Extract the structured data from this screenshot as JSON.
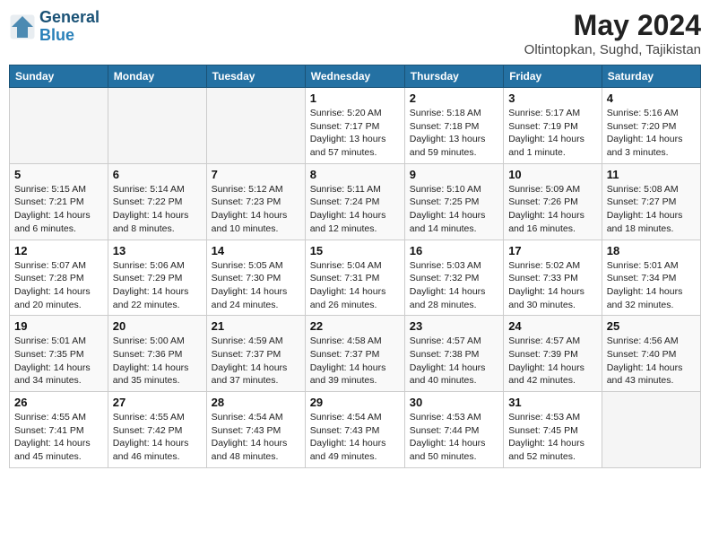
{
  "header": {
    "logo_line1": "General",
    "logo_line2": "Blue",
    "month": "May 2024",
    "location": "Oltintopkan, Sughd, Tajikistan"
  },
  "days_of_week": [
    "Sunday",
    "Monday",
    "Tuesday",
    "Wednesday",
    "Thursday",
    "Friday",
    "Saturday"
  ],
  "weeks": [
    [
      {
        "day": "",
        "empty": true
      },
      {
        "day": "",
        "empty": true
      },
      {
        "day": "",
        "empty": true
      },
      {
        "day": "1",
        "sunrise": "Sunrise: 5:20 AM",
        "sunset": "Sunset: 7:17 PM",
        "daylight": "Daylight: 13 hours and 57 minutes."
      },
      {
        "day": "2",
        "sunrise": "Sunrise: 5:18 AM",
        "sunset": "Sunset: 7:18 PM",
        "daylight": "Daylight: 13 hours and 59 minutes."
      },
      {
        "day": "3",
        "sunrise": "Sunrise: 5:17 AM",
        "sunset": "Sunset: 7:19 PM",
        "daylight": "Daylight: 14 hours and 1 minute."
      },
      {
        "day": "4",
        "sunrise": "Sunrise: 5:16 AM",
        "sunset": "Sunset: 7:20 PM",
        "daylight": "Daylight: 14 hours and 3 minutes."
      }
    ],
    [
      {
        "day": "5",
        "sunrise": "Sunrise: 5:15 AM",
        "sunset": "Sunset: 7:21 PM",
        "daylight": "Daylight: 14 hours and 6 minutes."
      },
      {
        "day": "6",
        "sunrise": "Sunrise: 5:14 AM",
        "sunset": "Sunset: 7:22 PM",
        "daylight": "Daylight: 14 hours and 8 minutes."
      },
      {
        "day": "7",
        "sunrise": "Sunrise: 5:12 AM",
        "sunset": "Sunset: 7:23 PM",
        "daylight": "Daylight: 14 hours and 10 minutes."
      },
      {
        "day": "8",
        "sunrise": "Sunrise: 5:11 AM",
        "sunset": "Sunset: 7:24 PM",
        "daylight": "Daylight: 14 hours and 12 minutes."
      },
      {
        "day": "9",
        "sunrise": "Sunrise: 5:10 AM",
        "sunset": "Sunset: 7:25 PM",
        "daylight": "Daylight: 14 hours and 14 minutes."
      },
      {
        "day": "10",
        "sunrise": "Sunrise: 5:09 AM",
        "sunset": "Sunset: 7:26 PM",
        "daylight": "Daylight: 14 hours and 16 minutes."
      },
      {
        "day": "11",
        "sunrise": "Sunrise: 5:08 AM",
        "sunset": "Sunset: 7:27 PM",
        "daylight": "Daylight: 14 hours and 18 minutes."
      }
    ],
    [
      {
        "day": "12",
        "sunrise": "Sunrise: 5:07 AM",
        "sunset": "Sunset: 7:28 PM",
        "daylight": "Daylight: 14 hours and 20 minutes."
      },
      {
        "day": "13",
        "sunrise": "Sunrise: 5:06 AM",
        "sunset": "Sunset: 7:29 PM",
        "daylight": "Daylight: 14 hours and 22 minutes."
      },
      {
        "day": "14",
        "sunrise": "Sunrise: 5:05 AM",
        "sunset": "Sunset: 7:30 PM",
        "daylight": "Daylight: 14 hours and 24 minutes."
      },
      {
        "day": "15",
        "sunrise": "Sunrise: 5:04 AM",
        "sunset": "Sunset: 7:31 PM",
        "daylight": "Daylight: 14 hours and 26 minutes."
      },
      {
        "day": "16",
        "sunrise": "Sunrise: 5:03 AM",
        "sunset": "Sunset: 7:32 PM",
        "daylight": "Daylight: 14 hours and 28 minutes."
      },
      {
        "day": "17",
        "sunrise": "Sunrise: 5:02 AM",
        "sunset": "Sunset: 7:33 PM",
        "daylight": "Daylight: 14 hours and 30 minutes."
      },
      {
        "day": "18",
        "sunrise": "Sunrise: 5:01 AM",
        "sunset": "Sunset: 7:34 PM",
        "daylight": "Daylight: 14 hours and 32 minutes."
      }
    ],
    [
      {
        "day": "19",
        "sunrise": "Sunrise: 5:01 AM",
        "sunset": "Sunset: 7:35 PM",
        "daylight": "Daylight: 14 hours and 34 minutes."
      },
      {
        "day": "20",
        "sunrise": "Sunrise: 5:00 AM",
        "sunset": "Sunset: 7:36 PM",
        "daylight": "Daylight: 14 hours and 35 minutes."
      },
      {
        "day": "21",
        "sunrise": "Sunrise: 4:59 AM",
        "sunset": "Sunset: 7:37 PM",
        "daylight": "Daylight: 14 hours and 37 minutes."
      },
      {
        "day": "22",
        "sunrise": "Sunrise: 4:58 AM",
        "sunset": "Sunset: 7:37 PM",
        "daylight": "Daylight: 14 hours and 39 minutes."
      },
      {
        "day": "23",
        "sunrise": "Sunrise: 4:57 AM",
        "sunset": "Sunset: 7:38 PM",
        "daylight": "Daylight: 14 hours and 40 minutes."
      },
      {
        "day": "24",
        "sunrise": "Sunrise: 4:57 AM",
        "sunset": "Sunset: 7:39 PM",
        "daylight": "Daylight: 14 hours and 42 minutes."
      },
      {
        "day": "25",
        "sunrise": "Sunrise: 4:56 AM",
        "sunset": "Sunset: 7:40 PM",
        "daylight": "Daylight: 14 hours and 43 minutes."
      }
    ],
    [
      {
        "day": "26",
        "sunrise": "Sunrise: 4:55 AM",
        "sunset": "Sunset: 7:41 PM",
        "daylight": "Daylight: 14 hours and 45 minutes."
      },
      {
        "day": "27",
        "sunrise": "Sunrise: 4:55 AM",
        "sunset": "Sunset: 7:42 PM",
        "daylight": "Daylight: 14 hours and 46 minutes."
      },
      {
        "day": "28",
        "sunrise": "Sunrise: 4:54 AM",
        "sunset": "Sunset: 7:43 PM",
        "daylight": "Daylight: 14 hours and 48 minutes."
      },
      {
        "day": "29",
        "sunrise": "Sunrise: 4:54 AM",
        "sunset": "Sunset: 7:43 PM",
        "daylight": "Daylight: 14 hours and 49 minutes."
      },
      {
        "day": "30",
        "sunrise": "Sunrise: 4:53 AM",
        "sunset": "Sunset: 7:44 PM",
        "daylight": "Daylight: 14 hours and 50 minutes."
      },
      {
        "day": "31",
        "sunrise": "Sunrise: 4:53 AM",
        "sunset": "Sunset: 7:45 PM",
        "daylight": "Daylight: 14 hours and 52 minutes."
      },
      {
        "day": "",
        "empty": true
      }
    ]
  ]
}
